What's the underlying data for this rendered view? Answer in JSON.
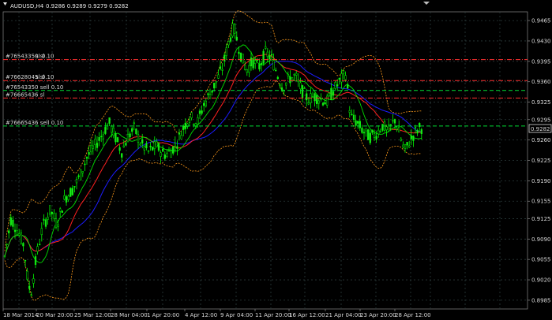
{
  "header": {
    "symbol_period": "AUDUSD,H4",
    "quotes": "0.9286 0.9289 0.9279 0.9282"
  },
  "colors": {
    "background": "#000000",
    "grid": "#2b3b3b",
    "bull_bar": "#00ff00",
    "bear_bar": "#22dd22",
    "ma_fast": "#00e000",
    "ma_slow": "#ff2020",
    "ma_long": "#1c1cff",
    "bollinger": "#ff9a1a",
    "sl_line": "#ff3030",
    "order_line": "#00dd33",
    "text": "#d8d8d8"
  },
  "price_axis": {
    "ticks": [
      "0.9465",
      "0.9430",
      "0.9395",
      "0.9360",
      "0.9325",
      "0.9295",
      "0.9260",
      "0.9225",
      "0.9190",
      "0.9155",
      "0.9125",
      "0.9090",
      "0.9055",
      "0.9020",
      "0.8985"
    ],
    "current_price": "0.9282"
  },
  "time_axis": {
    "ticks": [
      "18 Mar 2014",
      "20 Mar 20:00",
      "25 Mar 12:00",
      "28 Mar 04:00",
      "1 Apr 20:00",
      "4 Apr 12:00",
      "9 Apr 04:00",
      "11 Apr 20:00",
      "16 Apr 12:00",
      "21 Apr 04:00",
      "23 Apr 20:00",
      "28 Apr 12:00"
    ]
  },
  "order_lines": [
    {
      "label": "#76543350 sl",
      "extra": "sl 0.10",
      "price": 0.9398,
      "type": "sl"
    },
    {
      "label": "#76628045 sl",
      "extra": "sl 0.10",
      "price": 0.9362,
      "type": "sl"
    },
    {
      "label": "#76543350 sell 0.10",
      "extra": "",
      "price": 0.9345,
      "type": "order"
    },
    {
      "label": "#76665436 sl",
      "extra": "",
      "price": 0.9332,
      "type": "sl"
    },
    {
      "label": "#76665436 sell 0.10",
      "extra": "",
      "price": 0.9284,
      "type": "order"
    }
  ],
  "chart_data": {
    "type": "line",
    "title": "AUDUSD,H4",
    "x": [
      "18 Mar 2014",
      "20 Mar 20:00",
      "25 Mar 12:00",
      "28 Mar 04:00",
      "1 Apr 20:00",
      "4 Apr 12:00",
      "9 Apr 04:00",
      "11 Apr 20:00",
      "16 Apr 12:00",
      "21 Apr 04:00",
      "23 Apr 20:00",
      "28 Apr 12:00"
    ],
    "ylim": [
      0.897,
      0.948
    ],
    "series": [
      {
        "values": [
          0.908,
          0.9045,
          0.9155,
          0.9265,
          0.924,
          0.9285,
          0.944,
          0.9375,
          0.934,
          0.935,
          0.9275,
          0.9282
        ]
      }
    ],
    "grid": true
  }
}
